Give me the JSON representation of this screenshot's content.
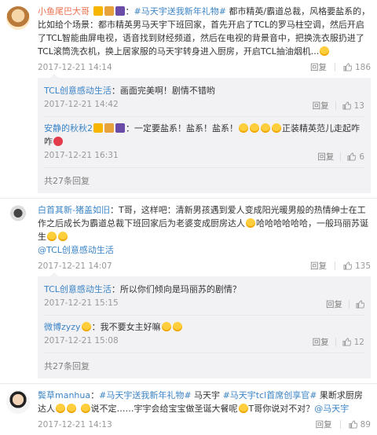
{
  "colors": {
    "accent": "#eb7350",
    "link": "#3b84c6",
    "meta": "#999999",
    "reply_bg": "#f2f2f5"
  },
  "comments": [
    {
      "user": "小鱼尾巴大哥",
      "text_a": "：",
      "hashtag": "#马天宇送我新年礼物#",
      "text_b": "都市精英/霸道总裁，风格要盐系的，比如给个场景：都市精英男马天宇下班回家，首先开启了TCL的罗马柱空调，然后开启了TCL智能曲屏电视，语音找到财经频道，然后在电视的背景音中，把换洗衣服扔进了TCL滚筒洗衣机，换上居家服的马天宇转身进入厨房，开启TCL抽油烟机...",
      "time": "2017-12-21 14:14",
      "reply_label": "回复",
      "likes": "186",
      "replies": [
        {
          "user": "TCL创意感动生活",
          "text": "：画面完美啊！剧情不错哟",
          "time": "2017-12-21 14:42",
          "reply_label": "回复",
          "likes": "13"
        },
        {
          "user": "安静的秋秋2",
          "text": "：一定要盐系！盐系！盐系！",
          "text2": "正装精英范儿走起咋咋",
          "time": "2017-12-21 16:31",
          "reply_label": "回复",
          "likes": "6"
        }
      ],
      "more": "共27条回复"
    },
    {
      "user": "白首其新-猪盖如旧",
      "text_a": "：T哥，这样吧：清新男孩遇到爱人变成阳光暖男般的热情绅士在工作之后成长为霸道总裁下班回家后为老婆变成厨房达人",
      "text_b": "哈哈哈哈哈哈，一般玛丽苏诞生",
      "mention": "@TCL创意感动生活",
      "time": "2017-12-21 14:07",
      "reply_label": "回复",
      "likes": "135",
      "replies": [
        {
          "user": "TCL创意感动生活",
          "text": "：所以你们倾向是玛丽苏的剧情？",
          "time": "2017-12-21 15:15",
          "reply_label": "回复",
          "likes": ""
        },
        {
          "user": "微博zyzy",
          "text": "：我不要女主好嘛",
          "time": "2017-12-21 15:08",
          "reply_label": "回复",
          "likes": "12"
        }
      ],
      "more": "共27条回复"
    },
    {
      "user": "鬓草manhua",
      "text_a": "：",
      "hashtag1": "#马天宇送我新年礼物#",
      "text_mid": " 马天宇 ",
      "hashtag2": "#马天宇tcl首席创享官#",
      "text_b": " 果断求厨房达人",
      "text_c": "说不定……宇宇会给宝宝做圣诞大餐呢",
      "text_d": "T哥你说对不对？",
      "mention": "@马天宇",
      "time": "2017-12-21 14:13",
      "reply_label": "回复",
      "likes": "89"
    }
  ]
}
